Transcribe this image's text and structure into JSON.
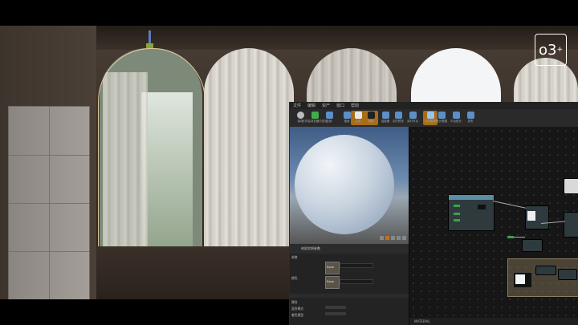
{
  "logo": {
    "text": "o3",
    "sup": "+"
  },
  "editor": {
    "menu": [
      "文件",
      "编辑",
      "资产",
      "窗口",
      "帮助"
    ],
    "toolbar": [
      {
        "label": "保存"
      },
      {
        "label": "在内容浏览器中查找"
      },
      {
        "label": "应用"
      },
      {
        "label": "搜索"
      },
      {
        "label": "主页"
      },
      {
        "label": "清理"
      },
      {
        "label": "连接器"
      },
      {
        "label": "实时预览"
      },
      {
        "label": "实时节点"
      },
      {
        "label": "实时更新"
      },
      {
        "label": "统计数据"
      },
      {
        "label": "平台统计"
      },
      {
        "label": "发布"
      }
    ],
    "details_title": "材质实例参数",
    "details_rows": [
      "参数",
      "Base",
      "颜色",
      "Base",
      "属性",
      "混合模式",
      "着色模型"
    ],
    "graph_status": "MATERIAL"
  }
}
